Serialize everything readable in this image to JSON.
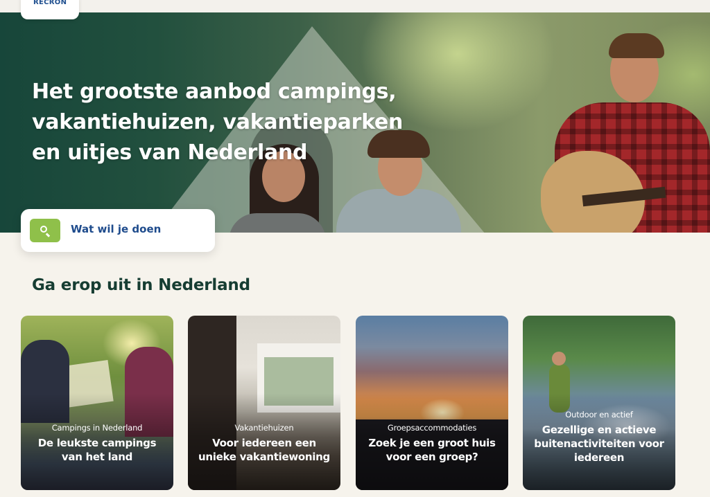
{
  "brand": {
    "logo_text": "RECRON"
  },
  "hero": {
    "title": "Het grootste aanbod campings, vakantiehuizen, vakantieparken en uitjes van Nederland"
  },
  "search": {
    "label": "Wat wil je doen",
    "button_icon": "search-icon",
    "button_color": "#8fc04a"
  },
  "section": {
    "title": "Ga erop uit in Nederland"
  },
  "cards": [
    {
      "category": "Campings in Nederland",
      "title": "De leukste campings van het land"
    },
    {
      "category": "Vakantiehuizen",
      "title": "Voor iedereen een unieke vakantiewoning"
    },
    {
      "category": "Groepsaccommodaties",
      "title": "Zoek je een groot huis voor een groep?"
    },
    {
      "category": "Outdoor en actief",
      "title": "Gezellige en actieve buitenactiviteiten voor iedereen"
    }
  ],
  "colors": {
    "page_background": "#f6f3ec",
    "heading": "#163d32",
    "link_blue": "#1e4b8c",
    "accent_green": "#8fc04a"
  }
}
